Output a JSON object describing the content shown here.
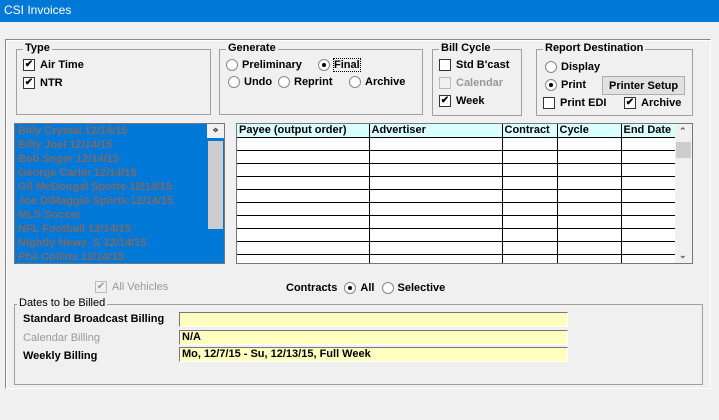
{
  "window": {
    "title": "CSI Invoices"
  },
  "type": {
    "label": "Type",
    "air_time": {
      "label": "Air Time",
      "checked": true
    },
    "ntr": {
      "label": "NTR",
      "checked": true
    }
  },
  "generate": {
    "label": "Generate",
    "options": [
      "Preliminary",
      "Final",
      "Undo",
      "Reprint",
      "Archive"
    ],
    "selected": "Final"
  },
  "bill_cycle": {
    "label": "Bill Cycle",
    "std_bcast": {
      "label": "Std B'cast",
      "checked": false
    },
    "calendar": {
      "label": "Calendar",
      "checked": false,
      "disabled": true
    },
    "week": {
      "label": "Week",
      "checked": true
    }
  },
  "report_destination": {
    "label": "Report Destination",
    "display": "Display",
    "print": "Print",
    "selected": "Print",
    "printer_setup": "Printer Setup",
    "print_edi": {
      "label": "Print EDI",
      "checked": false
    },
    "archive": {
      "label": "Archive",
      "checked": true
    }
  },
  "vehicles": [
    "Billy Crystal 12/14/15",
    "Billy Joel 12/14/15",
    "Bob Seger 12/14/15",
    "George Carlin 12/14/15",
    "Gil McDougal Sports 12/14/15",
    "Joe DiMaggio Sports 12/14/15",
    "MLS Soccer",
    "NFL Football 12/14/15",
    "Nightly News_S 12/14/15",
    "Phil Collins 12/14/15"
  ],
  "grid": {
    "columns": [
      "Payee (output order)",
      "Advertiser",
      "Contract",
      "Cycle",
      "End Date"
    ]
  },
  "all_vehicles": {
    "label": "All Vehicles",
    "checked": true,
    "disabled": true
  },
  "contracts": {
    "label": "Contracts",
    "options": [
      "All",
      "Selective"
    ],
    "selected": "All"
  },
  "dates": {
    "label": "Dates to be Billed",
    "standard": {
      "label": "Standard Broadcast Billing",
      "value": ""
    },
    "calendar": {
      "label": "Calendar Billing",
      "value": "N/A"
    },
    "weekly": {
      "label": "Weekly Billing",
      "value": "Mo, 12/7/15 - Su, 12/13/15, Full Week"
    }
  },
  "colors": {
    "titlebar": "#0078d7",
    "list_selection": "#0078d7",
    "grid_header": "#d9ffff",
    "field_bg": "#ffffc0"
  }
}
